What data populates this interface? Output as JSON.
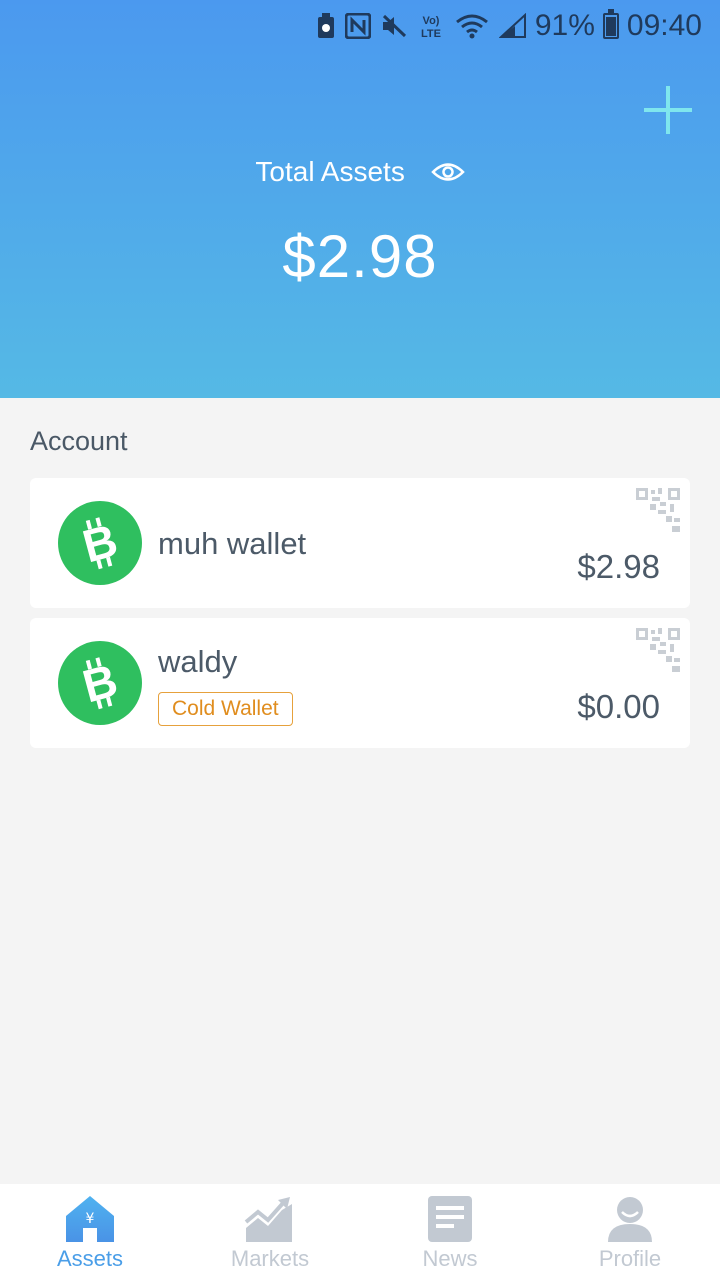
{
  "status_bar": {
    "battery": "91%",
    "time": "09:40",
    "network": "Vo) LTE"
  },
  "header": {
    "total_label": "Total Assets",
    "total_value": "$2.98"
  },
  "account": {
    "section_title": "Account",
    "wallets": [
      {
        "name": "muh wallet",
        "amount": "$2.98",
        "badge": ""
      },
      {
        "name": "waldy",
        "amount": "$0.00",
        "badge": "Cold Wallet"
      }
    ]
  },
  "tabs": [
    {
      "label": "Assets",
      "active": true
    },
    {
      "label": "Markets",
      "active": false
    },
    {
      "label": "News",
      "active": false
    },
    {
      "label": "Profile",
      "active": false
    }
  ],
  "colors": {
    "header_top": "#4b99ef",
    "header_bottom": "#55b9e5",
    "coin_green": "#2fbf5f",
    "badge_orange": "#e08d1e",
    "tab_active": "#4a9ee8",
    "tab_inactive": "#c2c9d2"
  },
  "icons": {
    "coin": "bitcoin-cash-icon",
    "qr": "qr-code-icon",
    "eye": "eye-icon",
    "add": "plus-icon"
  }
}
